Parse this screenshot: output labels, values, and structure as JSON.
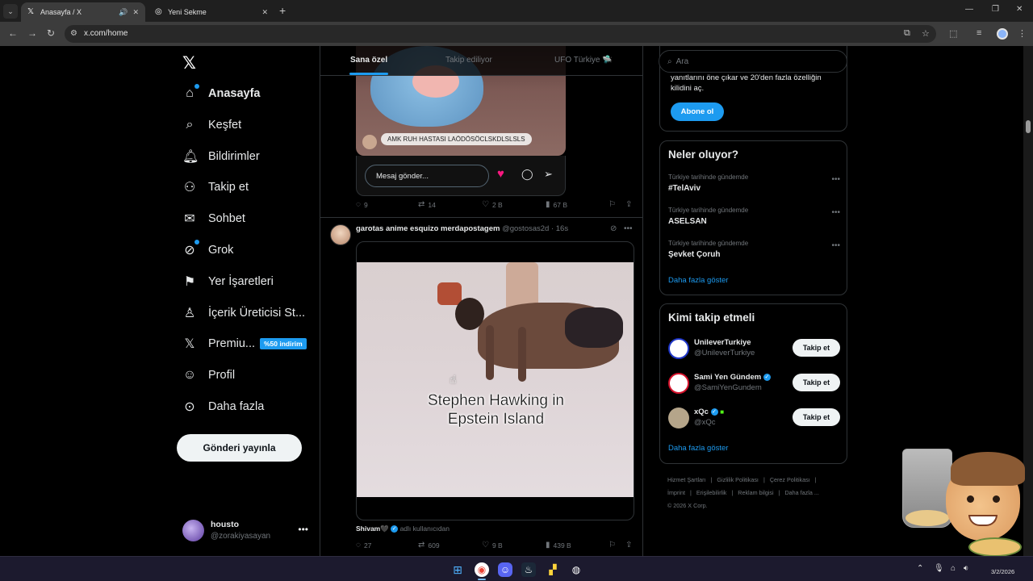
{
  "browser": {
    "tabs": [
      {
        "title": "Anasayfa / X",
        "active": true
      },
      {
        "title": "Yeni Sekme",
        "active": false
      }
    ],
    "url": "x.com/home"
  },
  "sidebar": {
    "items": [
      {
        "label": "Anasayfa",
        "icon": "home-icon"
      },
      {
        "label": "Keşfet",
        "icon": "search-icon"
      },
      {
        "label": "Bildirimler",
        "icon": "bell-icon"
      },
      {
        "label": "Takip et",
        "icon": "add-user-icon"
      },
      {
        "label": "Sohbet",
        "icon": "mail-icon"
      },
      {
        "label": "Grok",
        "icon": "grok-icon"
      },
      {
        "label": "Yer İşaretleri",
        "icon": "bookmark-icon"
      },
      {
        "label": "İçerik Üreticisi St...",
        "icon": "creator-icon"
      },
      {
        "label": "Premiu...",
        "icon": "x-logo-icon"
      },
      {
        "label": "Profil",
        "icon": "person-icon"
      },
      {
        "label": "Daha fazla",
        "icon": "more-circle-icon"
      }
    ],
    "premium_badge": "%50 indirim",
    "post_button": "Gönderi yayınla",
    "account": {
      "name": "housto",
      "handle": "@zorakiyasayan"
    }
  },
  "feed": {
    "tabs": [
      "Sana özel",
      "Takip ediliyor",
      "UFO Türkiye 🛸"
    ],
    "post1": {
      "caption": "AMK RUH HASTASI LAÖDÖSÖCLSKDLSLSLS",
      "message_placeholder": "Mesaj gönder...",
      "stats": {
        "replies": "9",
        "reposts": "14",
        "likes": "2 B",
        "views": "67 B"
      }
    },
    "post2": {
      "author": "garotas anime esquizo merdapostagem",
      "handle_time": "@gostosas2d · 16s",
      "video_caption_line1": "Stephen Hawking in",
      "video_caption_line2": "Epstein Island",
      "reply_user": "Shivam🖤",
      "reply_suffix": "adlı kullanıcıdan",
      "stats": {
        "replies": "27",
        "reposts": "609",
        "likes": "9 B",
        "views": "439 B"
      }
    }
  },
  "right": {
    "search_placeholder": "Ara",
    "premium_text": "yanıtlarını öne çıkar ve 20'den fazla özelliğin kilidini aç.",
    "subscribe": "Abone ol",
    "trends_title": "Neler oluyor?",
    "trends": [
      {
        "category": "Türkiye tarihinde gündemde",
        "name": "#TelAviv"
      },
      {
        "category": "Türkiye tarihinde gündemde",
        "name": "ASELSAN"
      },
      {
        "category": "Türkiye tarihinde gündemde",
        "name": "Şevket Çoruh"
      }
    ],
    "show_more": "Daha fazla göster",
    "follow_title": "Kimi takip etmeli",
    "follow": [
      {
        "name": "UnileverTurkiye",
        "handle": "@UnileverTurkiye",
        "button": "Takip et"
      },
      {
        "name": "Sami Yen Gündem",
        "handle": "@SamiYenGundem",
        "button": "Takip et"
      },
      {
        "name": "xQc",
        "handle": "@xQc",
        "button": "Takip et"
      }
    ],
    "footer": [
      "Hizmet Şartları",
      "|",
      "Gizlilik Politikası",
      "|",
      "Çerez Politikası",
      "|",
      "İmprint",
      "|",
      "Erişilebilirlik",
      "|",
      "Reklam bilgisi",
      "|",
      "Daha fazla ...",
      "© 2026 X Corp."
    ]
  },
  "taskbar": {
    "date": "3/2/2026"
  }
}
